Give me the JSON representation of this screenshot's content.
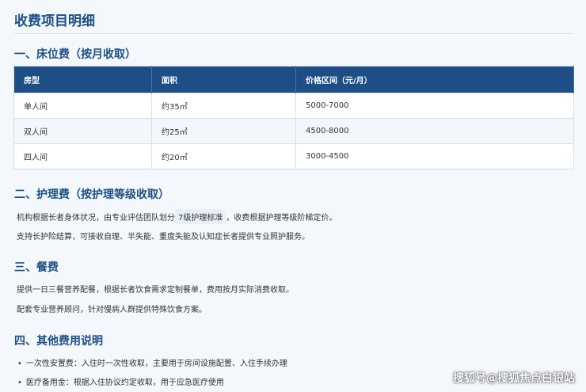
{
  "page_title": "收费项目明细",
  "section1": {
    "heading": "一、床位费（按月收取）",
    "table": {
      "headers": [
        "房型",
        "面积",
        "价格区间（元/月）"
      ],
      "rows": [
        [
          "单人间",
          "约35㎡",
          "5000-7000"
        ],
        [
          "双人间",
          "约25㎡",
          "4500-8000"
        ],
        [
          "四人间",
          "约20㎡",
          "3000-4500"
        ]
      ]
    }
  },
  "section2": {
    "heading": "二、护理费（按护理等级收取）",
    "para1_pre": "机构根据长者身体状况，由专业评估团队划分",
    "para1_tag": "7级护理标准",
    "para1_post": "，收费根据护理等级阶梯定价。",
    "para2": "支持长护险结算，可接收自理、半失能、重度失能及认知症长者提供专业照护服务。"
  },
  "section3": {
    "heading": "三、餐费",
    "para1": "提供一日三餐营养配餐，根据长者饮食需求定制餐单，费用按月实际消费收取。",
    "para2": "配套专业营养顾问，针对慢病人群提供特殊饮食方案。"
  },
  "section4": {
    "heading": "四、其他费用说明",
    "bullets": [
      "一次性安置费：入住时一次性收取，主要用于房间设施配置、入住手续办理",
      "医疗备用金：根据入住协议约定收取，用于应急医疗使用"
    ],
    "bullet_symbol": "•"
  },
  "watermark": "搜狐号@搜狐焦点白银站"
}
